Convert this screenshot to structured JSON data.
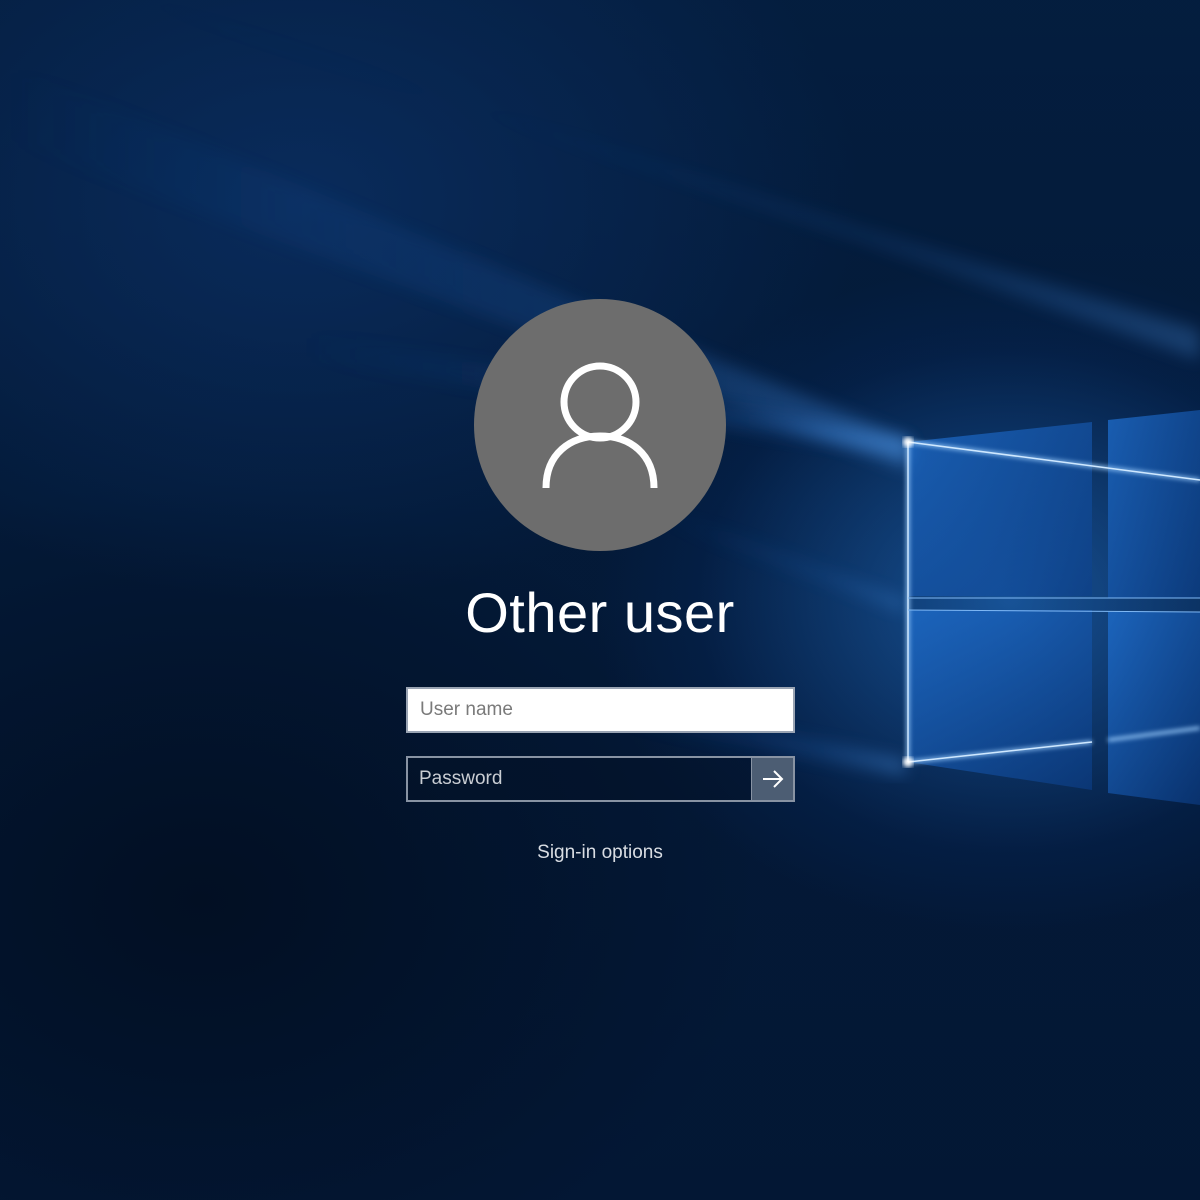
{
  "login": {
    "user_title": "Other user",
    "username_placeholder": "User name",
    "username_value": "",
    "password_placeholder": "Password",
    "password_value": "",
    "signin_options_label": "Sign-in options"
  },
  "icons": {
    "avatar": "person-outline-icon",
    "submit": "arrow-right-icon",
    "background_logo": "windows-logo-icon"
  },
  "colors": {
    "avatar_bg": "#6d6d6d",
    "accent_glow": "#3a8ef0",
    "background": "#03152e"
  }
}
